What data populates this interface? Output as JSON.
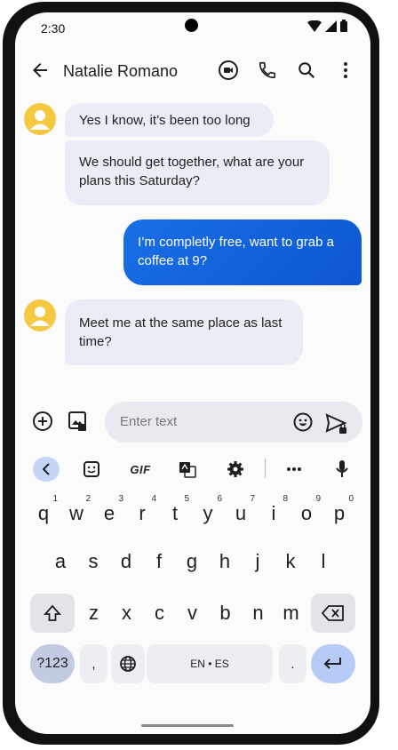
{
  "status_bar": {
    "time": "2:30"
  },
  "app_bar": {
    "contact_name": "Natalie Romano"
  },
  "messages": [
    {
      "direction": "incoming",
      "text": "Yes I know, it’s been too long"
    },
    {
      "direction": "incoming",
      "text": "We should get together, what are your plans this Saturday?"
    },
    {
      "direction": "outgoing",
      "text": "I’m completly free, want to grab a coffee at 9?"
    },
    {
      "direction": "incoming",
      "text": "Meet me at the same place as last time?"
    }
  ],
  "compose": {
    "placeholder": "Enter text"
  },
  "keyboard": {
    "toolbar": {
      "gif_label": "GIF"
    },
    "row1": [
      {
        "key": "q",
        "hint": "1"
      },
      {
        "key": "w",
        "hint": "2"
      },
      {
        "key": "e",
        "hint": "3"
      },
      {
        "key": "r",
        "hint": "4"
      },
      {
        "key": "t",
        "hint": "5"
      },
      {
        "key": "y",
        "hint": "6"
      },
      {
        "key": "u",
        "hint": "7"
      },
      {
        "key": "i",
        "hint": "8"
      },
      {
        "key": "o",
        "hint": "9"
      },
      {
        "key": "p",
        "hint": "0"
      }
    ],
    "row2": [
      "a",
      "s",
      "d",
      "f",
      "g",
      "h",
      "j",
      "k",
      "l"
    ],
    "row3": [
      "z",
      "x",
      "c",
      "v",
      "b",
      "n",
      "m"
    ],
    "row4": {
      "symbols": "?123",
      "comma": ",",
      "space": "EN • ES",
      "period": "."
    }
  },
  "colors": {
    "outgoing_bubble": "#0b57d0",
    "incoming_bubble": "#eaedf5",
    "avatar": "#f5c842"
  }
}
